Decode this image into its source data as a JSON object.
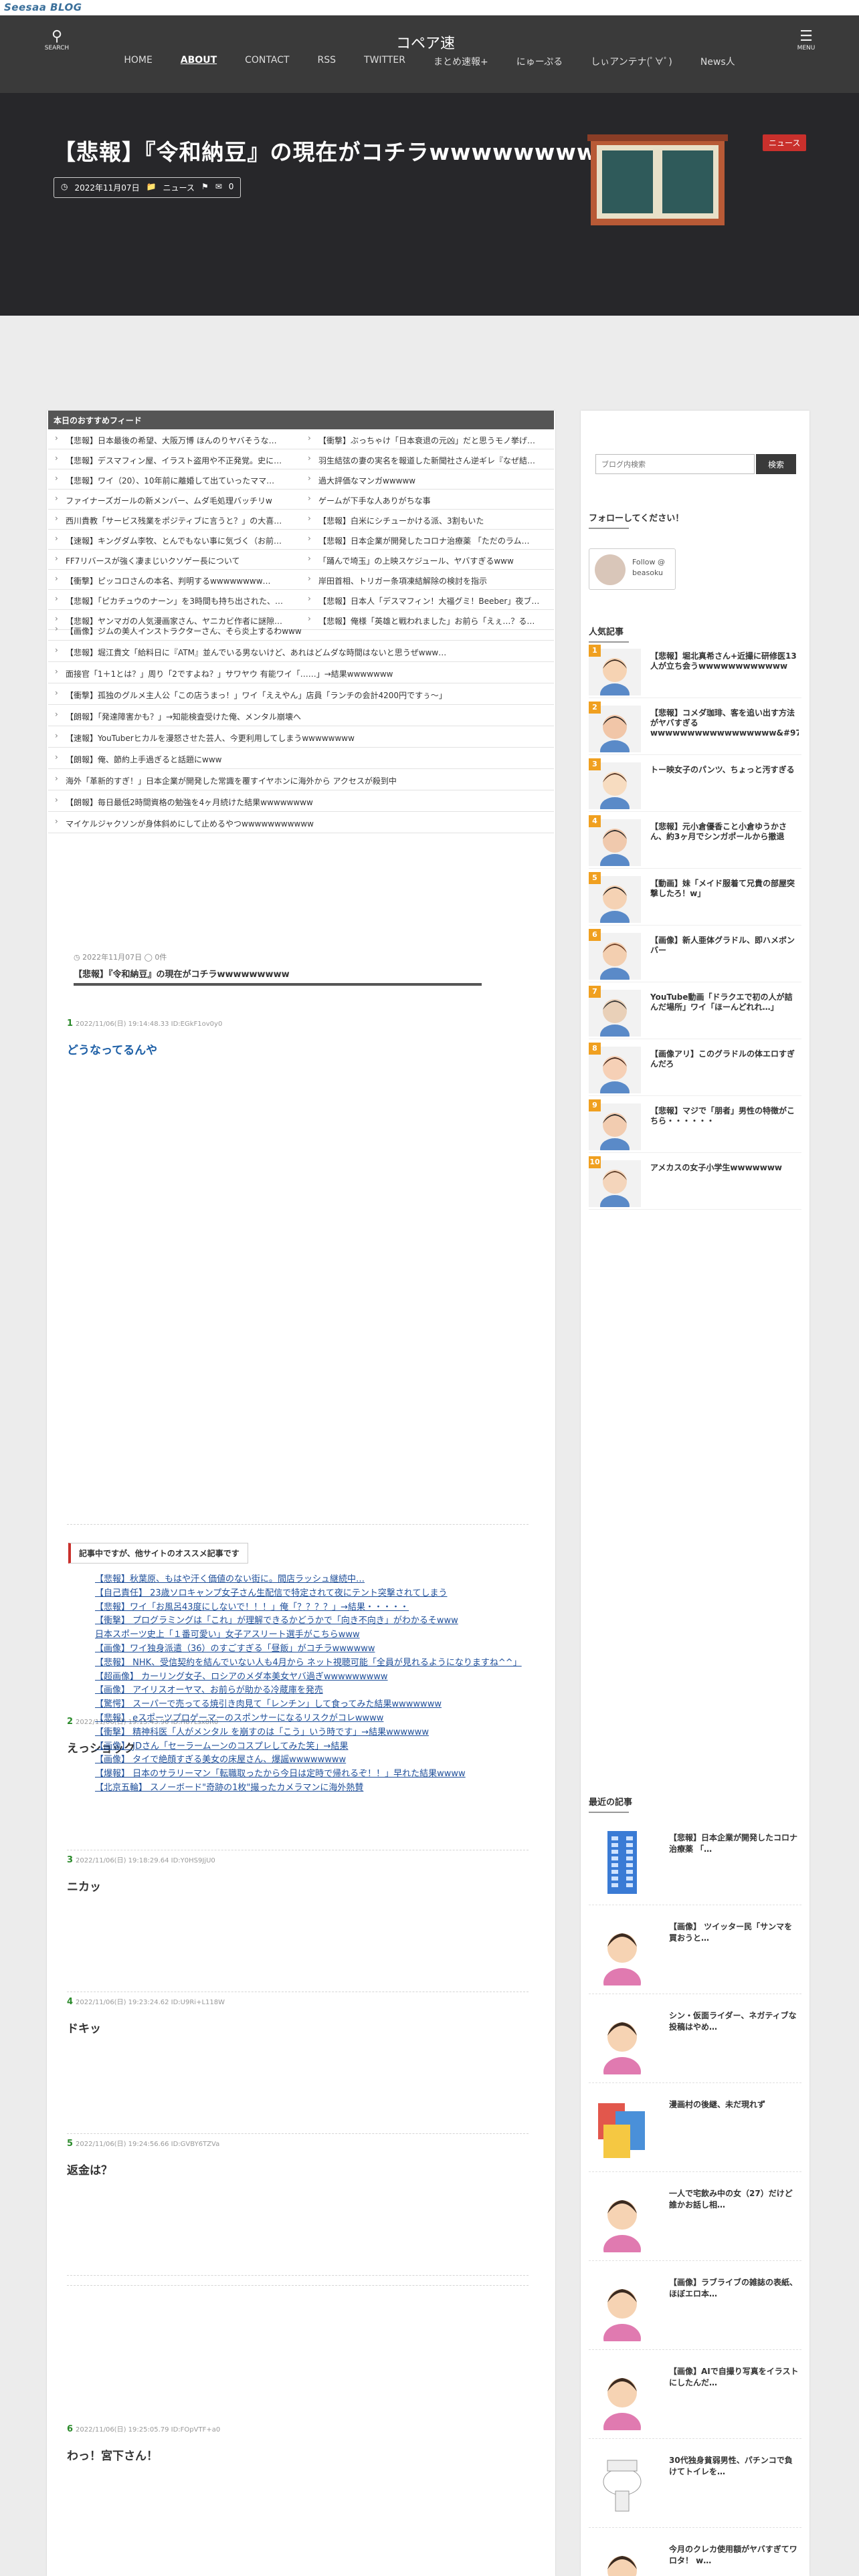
{
  "topbar": {
    "logo": "Seesaa BLOG"
  },
  "header": {
    "search_label": "SEARCH",
    "menu_label": "MENU",
    "site_name": "コペア速",
    "nav": [
      "HOME",
      "ABOUT",
      "CONTACT",
      "RSS",
      "TWITTER",
      "まとめ速報+",
      "にゅーぷる",
      "しぃアンテナ(ﾟ∀ﾟ)",
      "News人"
    ]
  },
  "hero": {
    "title": "【悲報】『令和納豆』の現在がコチラwwwwwwwww",
    "date": "2022年11月07日",
    "category": "ニュース",
    "comments": "0",
    "badge": "ニュース"
  },
  "pickup": {
    "heading": "本日のおすすめフィード",
    "pairs": [
      [
        "【悲報】日本最後の希望、大阪万博 ほんのりヤバそうな…",
        "【衝撃】ぶっちゃけ「日本衰退の元凶」だと思うモノ挙げ…"
      ],
      [
        "【悲報】デスマフィン屋、イラスト盗用や不正発覚。史に…",
        "羽生結弦の妻の実名を報道した新聞社さん逆ギレ『なぜ結…"
      ],
      [
        "【悲報】ワイ（20）、10年前に離婚して出ていったママ…",
        "過大評価なマンガwwwww"
      ],
      [
        "ファイナーズガールの新メンバー、ムダ毛処理バッチリw",
        "ゲームが下手な人ありがちな事"
      ],
      [
        "西川貴教「サービス残業をポジティブに言うと？」の大喜…",
        "【悲報】白米にシチューかける派、3割もいた"
      ],
      [
        "【速報】キングダム李牧、とんでもない事に気づく（お前…",
        "【悲報】日本企業が開発したコロナ治療薬 「ただのラム…"
      ],
      [
        "FF7リバースが強く凄まじいクソゲー長について",
        "「踊んで埼玉」の上映スケジュール、ヤバすぎるwww"
      ],
      [
        "【衝撃】ピッコロさんの本名、判明するwwwwwwww…",
        "岸田首相、トリガー条項凍結解除の検討を指示"
      ],
      [
        "【悲報】「ピカチュウのナーン」を3時間も持ち出された、…",
        "【悲報】日本人「デスマフィン！大福グミ！Beeber」夜ブ…"
      ],
      [
        "【悲報】ヤンマガの人気漫画家さん、ヤニカビ作者に謎隙…",
        "【悲報】俺様「英雄と戦われました」お前ら「えぇ…？る…"
      ]
    ],
    "single": [
      "【画像】ジムの美人インストラクターさん、そら炎上するわwww",
      "【悲報】堀江貴文「給料日に『ATM』並んでいる男ないけど、あれはどムダな時間はないと思うぜwww…",
      "面接官「1＋1とは？」周り「2ですよね？」サワヤウ 有能ワイ「……」→結果wwwwwww",
      "【衝撃】孤独のグルメ主人公「この店うまっ！」ワイ「ええやん」店員「ランチの会計4200円ですぅ～」",
      "【朗報】「発達障害かも？」→知能検査受けた俺、メンタル崩壊へ",
      "【速報】YouTuberヒカルを漫怒させた芸人、今更利用してしまうwwwwwwww",
      "【朗報】俺、節約上手過ぎると話題にwww",
      "海外「革新的すぎ！」日本企業が開発した常識を覆すイヤホンに海外から アクセスが殺到中",
      "【朗報】毎日最低2時間資格の勉強を4ヶ月続けた結果wwwwwwww",
      "マイケルジャクソンが身体斜めにして止めるやつwwwwwwwwwww"
    ]
  },
  "article": {
    "date": "2022年11月07日",
    "comments": "0件",
    "title": "【悲報】『令和納豆』の現在がコチラwwwwwwwww"
  },
  "responses": [
    {
      "num": "1",
      "meta": "2022/11/06(日) 19:14:48.33 ID:EGkF1ov0y0",
      "body": "どうなってるんや"
    },
    {
      "num": "2",
      "meta": "2022/11/06(日) 19:15:43.90 ID:H87Lsx8R0",
      "body": "えっショック"
    },
    {
      "num": "3",
      "meta": "2022/11/06(日) 19:18:29.64 ID:Y0HS9JjU0",
      "body": "ニカッ"
    },
    {
      "num": "4",
      "meta": "2022/11/06(日) 19:23:24.62 ID:U9Ri+L118W",
      "body": "ドキッ"
    },
    {
      "num": "5",
      "meta": "2022/11/06(日) 19:24:56.66 ID:GVBY6TZVa",
      "body": "返金は？"
    },
    {
      "num": "6",
      "meta": "2022/11/06(日) 19:25:05.79 ID:FOpVTF+a0",
      "body": "わっ！宮下さん！"
    }
  ],
  "recommend": {
    "title": "記事中ですが、他サイトのオススメ記事です",
    "items": [
      "【悲報】秋葉原、もはや汗く価値のない街に。間店ラッシュ継続中…",
      "【自己責任】 23歳ソロキャンプ女子さん生配信で特定されて夜にテント突撃されてしまう",
      "【悲報】ワイ「お風呂43度にしないで！！！」俺「？？？？」→結果・・・・・",
      "【衝撃】 プログラミングは「これ」が理解できるかどうかで「向き不向き」がわかるそwww",
      "日本スポーツ史上「１番可愛い」女子アスリート選手がこちらwww",
      "【画像】ワイ独身派遣（36）のすごすぎる「昼飯」がコチラwwwwww",
      "【悲報】 NHK、受信契約を結んでいない人も4月から ネット視聴可能「全員が見れるようになりますね^^」",
      "【超画像】 カーリング女子、ロシアのメダ本美女ヤバ過ぎwwwwwwwww",
      "【画像】 アイリスオーヤマ、お前らが助かる冷蔵庫を発売",
      "【驚愕】 スーパーで売ってる焼引き肉見て「レンチン」して食ってみた結果wwwwwww",
      "【悲報】 eスポーツプロゲーマーのスポンサーになるリスクがコレwwww",
      "【衝撃】 精神科医「人がメンタル を崩すのは「こう」いう時です」→結果wwwwww",
      "【画像】 JDさん「セーラームーンのコスプレしてみた笑」→結果",
      "【画像】 タイで絶顔すぎる美女の床屋さん、爆謡wwwwwwww",
      "【爆報】 日本のサラリーマン「転職取ったから今日は定時で帰れるぞ！！」早れた結果wwww",
      "【北京五輪】 スノーボード\"奇跡の1枚\"撮ったカメラマンに海外熱賛"
    ]
  },
  "sidebar": {
    "search_placeholder": "ブログ内検索",
    "search_button": "検索",
    "follow_title": "フォローしてください！",
    "follow_text": "Follow @ beasoku",
    "popular_title": "人気記事",
    "recent_title": "最近の記事",
    "popular": [
      {
        "rank": "1",
        "title": "【悲報】堀北真希さん+近撮に研修医13人が立ち会うwwwwwwwwwwww"
      },
      {
        "rank": "2",
        "title": "【悲報】コメダ珈琲、客を追い出す方法がヤバすぎるwwwwwwwwwwwwwwwww&#9749;"
      },
      {
        "rank": "3",
        "title": "トー映女子のパンツ、ちょっと汚すぎる"
      },
      {
        "rank": "4",
        "title": "【悲報】元小倉優香こと小倉ゆうかさん、約3ヶ月でシンガポールから撤退"
      },
      {
        "rank": "5",
        "title": "【動画】妹「メイド服着て兄貴の部屋突撃したろ！w」"
      },
      {
        "rank": "6",
        "title": "【画像】新人亜体グラドル、即ハメボンバー"
      },
      {
        "rank": "7",
        "title": "YouTube動画「ドラクエで初の人が詰んだ場所」ワイ「ほーんどれれ…」"
      },
      {
        "rank": "8",
        "title": "【画像アリ】このグラドルの体エロすぎんだろ"
      },
      {
        "rank": "9",
        "title": "【悲報】マジで「朋者」男性の特徴がこちら・・・・・・"
      },
      {
        "rank": "10",
        "title": "アメカスの女子小学生wwwwwww"
      }
    ],
    "recent": [
      "【悲報】日本企業が開発したコロナ治療薬 「…",
      "【画像】 ツイッター民「サンマを買おうと…",
      "シン・仮面ライダー、ネガティブな投稿はやめ…",
      "漫画村の後継、未だ現れず",
      "一人で宅飲み中の女（27）だけど誰かお話し相…",
      "【画像】ラブライブの雑誌の表紙、ほぼエロ本…",
      "【画像】AIで自撮り写真をイラストにしたんだ…",
      "30代独身貧弱男性、パチンコで負けてトイレを…",
      "今月のクレカ使用額がヤバすぎてワロタ！ w…"
    ]
  }
}
